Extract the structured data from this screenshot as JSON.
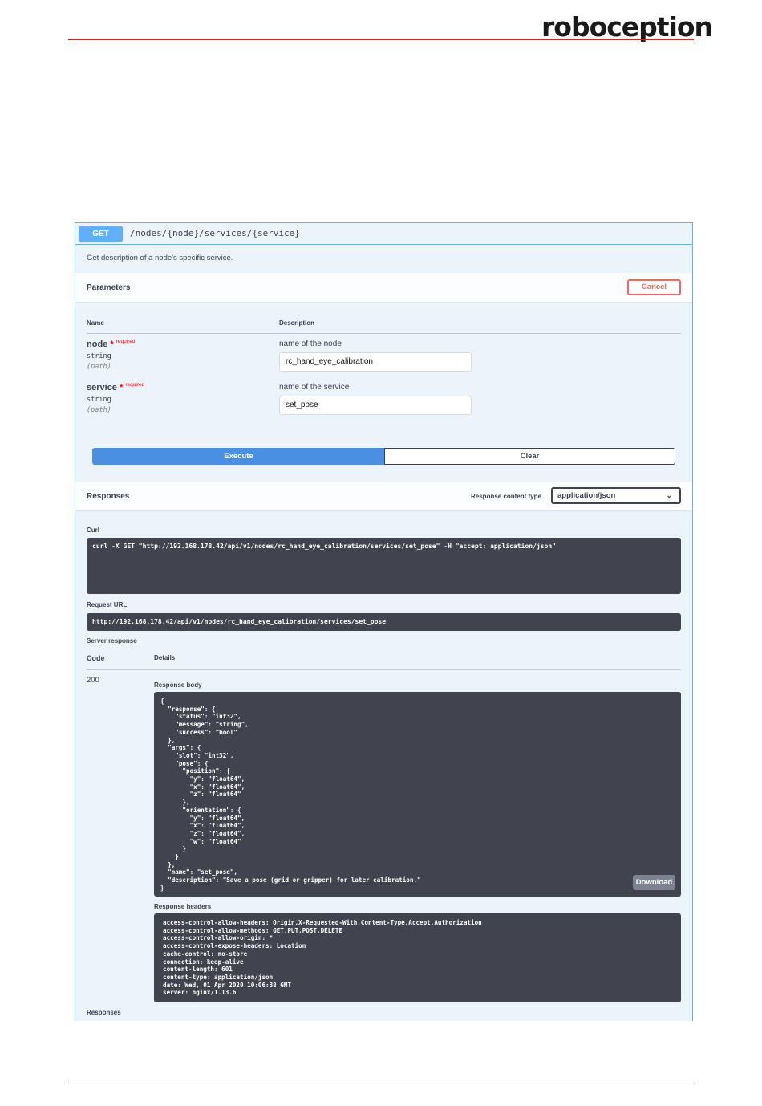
{
  "brand": {
    "logo_text": "roboception",
    "accent": "#d71f26"
  },
  "operation": {
    "method": "GET",
    "path": "/nodes/{node}/services/{service}",
    "description": "Get description of a node's specific service.",
    "accent": "#61affe"
  },
  "parameters": {
    "title": "Parameters",
    "cancel_label": "Cancel",
    "col_name": "Name",
    "col_description": "Description",
    "items": [
      {
        "name": "node",
        "star": "*",
        "required": "required",
        "type": "string",
        "in": "(path)",
        "description": "name of the node",
        "value": "rc_hand_eye_calibration"
      },
      {
        "name": "service",
        "star": "*",
        "required": "required",
        "type": "string",
        "in": "(path)",
        "description": "name of the service",
        "value": "set_pose"
      }
    ],
    "execute_label": "Execute",
    "clear_label": "Clear"
  },
  "responses": {
    "title": "Responses",
    "content_type_label": "Response content type",
    "content_type_value": "application/json",
    "curl_label": "Curl",
    "curl_command": "curl -X GET \"http://192.168.178.42/api/v1/nodes/rc_hand_eye_calibration/services/set_pose\" -H \"accept: application/json\"",
    "request_url_label": "Request URL",
    "request_url": "http://192.168.178.42/api/v1/nodes/rc_hand_eye_calibration/services/set_pose",
    "server_response_label": "Server response",
    "col_code": "Code",
    "col_details": "Details",
    "status_code": "200",
    "body_label": "Response body",
    "body": "{\n  \"response\": {\n    \"status\": \"int32\",\n    \"message\": \"string\",\n    \"success\": \"bool\"\n  },\n  \"args\": {\n    \"slot\": \"int32\",\n    \"pose\": {\n      \"position\": {\n        \"y\": \"float64\",\n        \"x\": \"float64\",\n        \"z\": \"float64\"\n      },\n      \"orientation\": {\n        \"y\": \"float64\",\n        \"x\": \"float64\",\n        \"z\": \"float64\",\n        \"w\": \"float64\"\n      }\n    }\n  },\n  \"name\": \"set_pose\",\n  \"description\": \"Save a pose (grid or gripper) for later calibration.\"\n}",
    "download_label": "Download",
    "headers_label": "Response headers",
    "headers": "access-control-allow-headers: Origin,X-Requested-With,Content-Type,Accept,Authorization\naccess-control-allow-methods: GET,PUT,POST,DELETE\naccess-control-allow-origin: *\naccess-control-expose-headers: Location\ncache-control: no-store\nconnection: keep-alive\ncontent-length: 601\ncontent-type: application/json\ndate: Wed, 01 Apr 2020 10:06:38 GMT\nserver: nginx/1.13.6",
    "footer_label": "Responses"
  }
}
